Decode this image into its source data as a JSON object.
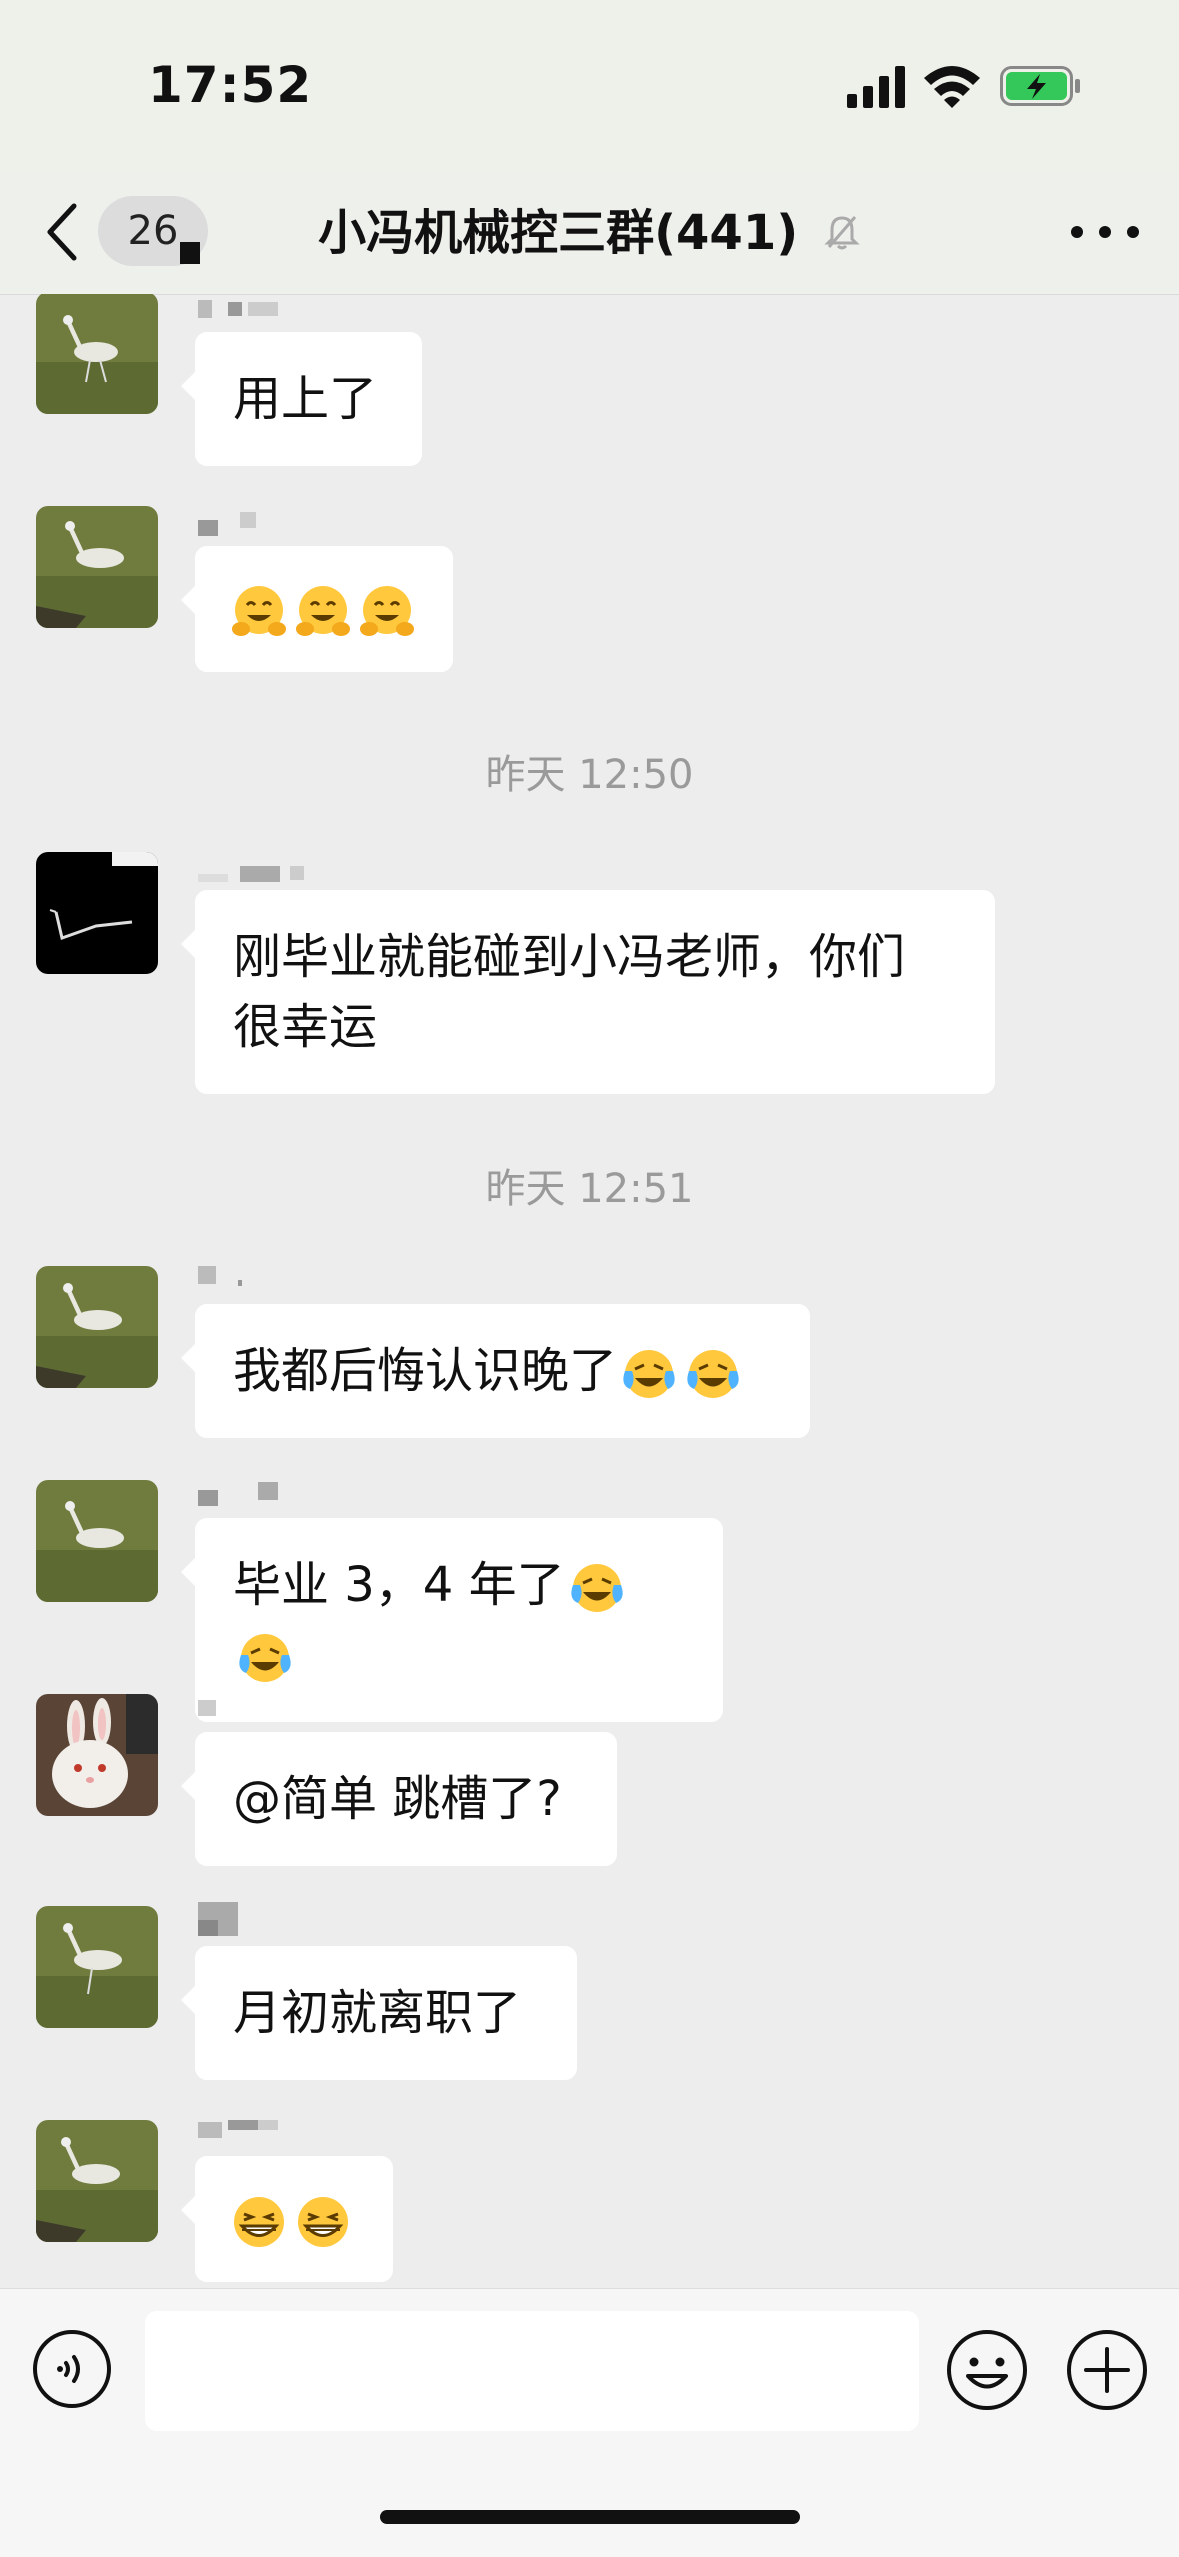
{
  "status_bar": {
    "time": "17:52"
  },
  "nav": {
    "unread_count": "26",
    "title": "小冯机械控三群(441)"
  },
  "icons": {
    "back": "chevron-left-icon",
    "mute": "bell-off-icon",
    "more": "more-horizontal-icon",
    "voice": "voice-icon",
    "emoji": "smile-icon",
    "plus": "plus-circle-icon"
  },
  "colors": {
    "bubble": "#ffffff",
    "chat_bg": "#ededed",
    "battery": "#34c759"
  },
  "messages": {
    "m1": {
      "text": "用上了"
    },
    "m2": {
      "emojis": [
        "hugging",
        "hugging",
        "hugging"
      ]
    },
    "ts1": "昨天 12:50",
    "m3": {
      "line1": "刚毕业就能碰到小冯老师，你们",
      "line2": "很幸运"
    },
    "ts2": "昨天 12:51",
    "m4": {
      "text": "我都后悔认识晚了",
      "emojis": [
        "crying-laughing",
        "crying-laughing"
      ]
    },
    "m5": {
      "text": "毕业 3，4 年了",
      "emojis": [
        "crying-laughing",
        "crying-laughing"
      ]
    },
    "m6": {
      "text": "@简单 跳槽了?"
    },
    "m7": {
      "text": "月初就离职了"
    },
    "m8": {
      "emojis": [
        "grinning",
        "grinning"
      ]
    }
  }
}
